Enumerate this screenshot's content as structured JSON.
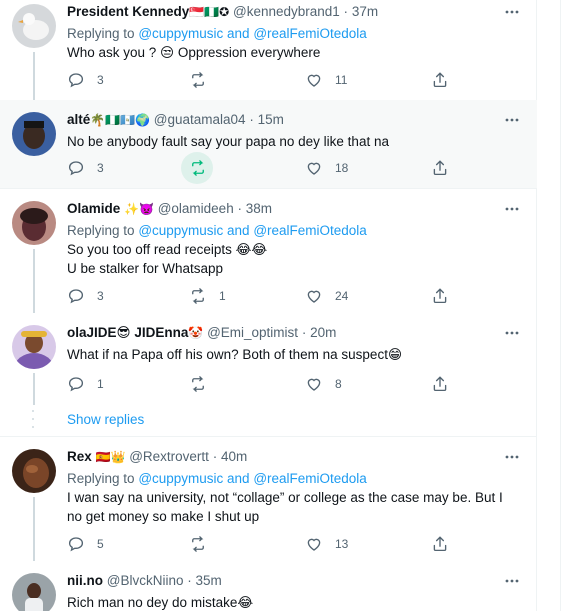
{
  "tweets": [
    {
      "name": "President Kennedy",
      "name_emoji": "🇸🇬🇳🇬✪",
      "handle": "@kennedybrand1",
      "time": "37m",
      "replying_prefix": "Replying to",
      "replying_to": "@cuppymusic and @realFemiOtedola",
      "lines": [
        "Who ask you ? 😒 Oppression everywhere"
      ],
      "replies": "3",
      "retweets": "",
      "likes": "11",
      "retweeted": false,
      "avatar_color": "#c9ccd0"
    },
    {
      "name": "alté",
      "name_emoji": "🌴🇳🇬🇬🇹🌍",
      "handle": "@guatamala04",
      "time": "15m",
      "replying_prefix": "",
      "replying_to": "",
      "lines": [
        "No be anybody fault say your papa no dey like that na"
      ],
      "replies": "3",
      "retweets": "",
      "likes": "18",
      "retweeted": true,
      "avatar_color": "#3a5fa0"
    },
    {
      "name": "Olamide",
      "name_emoji": "✨👿",
      "handle": "@olamideeh",
      "time": "38m",
      "replying_prefix": "Replying to",
      "replying_to": "@cuppymusic and @realFemiOtedola",
      "lines": [
        "So you too off read receipts 😂😂",
        "U be stalker for Whatsapp"
      ],
      "replies": "3",
      "retweets": "1",
      "likes": "24",
      "retweeted": false,
      "avatar_color": "#7a3e5a"
    },
    {
      "name": "olaJIDE😎 JIDEnna",
      "name_emoji": "🤡",
      "handle": "@Emi_optimist",
      "time": "20m",
      "replying_prefix": "",
      "replying_to": "",
      "lines": [
        "What if na Papa off his own? Both of them na suspect😁"
      ],
      "replies": "1",
      "retweets": "",
      "likes": "8",
      "retweeted": false,
      "avatar_color": "#7b5bb0"
    },
    {
      "name": "Rex",
      "name_emoji": "🇪🇸👑",
      "handle": "@Rextrovertt",
      "time": "40m",
      "replying_prefix": "Replying to",
      "replying_to": "@cuppymusic and @realFemiOtedola",
      "lines": [
        "I wan say na university, not “collage” or college as the case may be.  But I",
        "no get money so make I shut up"
      ],
      "replies": "5",
      "retweets": "",
      "likes": "13",
      "retweeted": false,
      "avatar_color": "#6b3a22"
    },
    {
      "name": "nii.no",
      "name_emoji": "",
      "handle": "@BlvckNiino",
      "time": "35m",
      "replying_prefix": "",
      "replying_to": "",
      "lines": [
        "Rich man no dey do mistake😂"
      ],
      "replies": "",
      "retweets": "",
      "likes": "",
      "retweeted": false,
      "avatar_color": "#8a9499"
    }
  ],
  "show_replies": "Show replies",
  "separator": "·",
  "colors": {
    "link": "#1d9bf0",
    "muted": "#536471",
    "retweet_active": "#00ba7c",
    "highlight_bg": "#f7f9f9"
  }
}
